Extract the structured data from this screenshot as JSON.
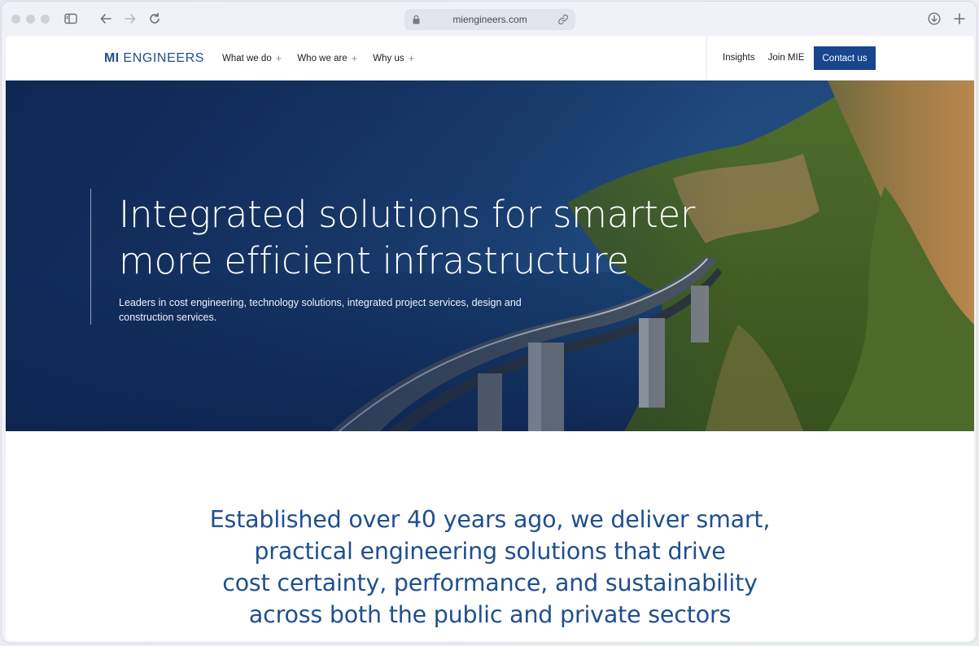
{
  "browser": {
    "url": "miengineers.com",
    "icons": [
      "sidebar-icon",
      "back-arrow-icon",
      "forward-arrow-icon",
      "reload-icon",
      "lock-icon",
      "link-icon",
      "download-icon",
      "new-tab-plus-icon"
    ]
  },
  "nav": {
    "logo_bold": "MI",
    "logo_rest": " ENGINEERS",
    "menu": [
      {
        "label": "What we do",
        "icon": "plus"
      },
      {
        "label": "Who we are",
        "icon": "plus"
      },
      {
        "label": "Why us",
        "icon": "plus"
      }
    ],
    "insights": "Insights",
    "join": "Join MIE",
    "contact": "Contact us"
  },
  "hero": {
    "title_line1": "Integrated solutions for smarter",
    "title_line2": "more efficient infrastructure",
    "subtitle": "Leaders in cost engineering, technology solutions, integrated project services, design and construction services.",
    "image": "coastal-bridge-photo"
  },
  "intro": {
    "lines": [
      "Established over 40 years ago, we deliver smart,",
      "practical engineering solutions that drive",
      "cost certainty, performance, and sustainability",
      "across both the public and private sectors"
    ]
  },
  "colors": {
    "brand": "#1F4F8F",
    "button": "#17468F",
    "hero_sea": "#13305F"
  }
}
